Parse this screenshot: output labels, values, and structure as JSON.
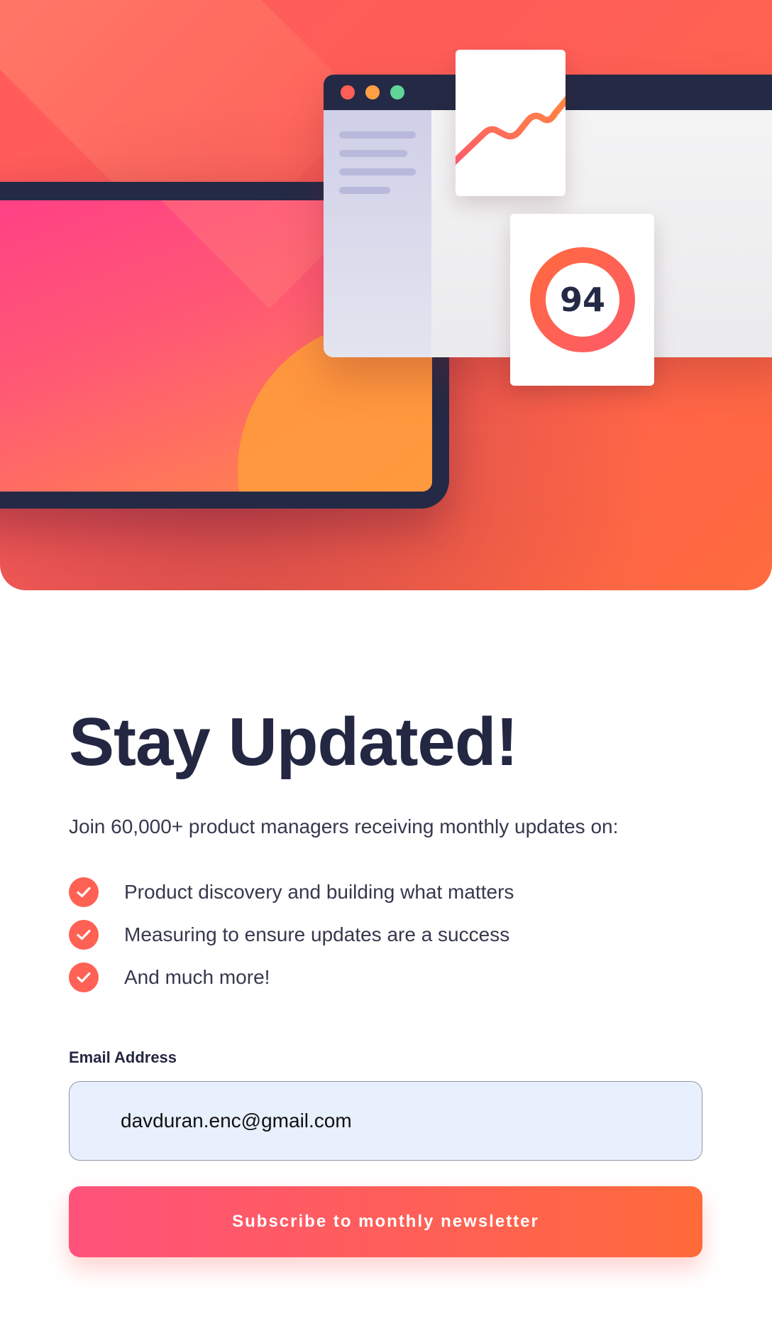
{
  "hero": {
    "score_card": {
      "value": "94"
    },
    "browser": {
      "window_dots": [
        "red",
        "orange",
        "green"
      ],
      "dot_colors": [
        "#ff5f57",
        "#ff9f43",
        "#5fd597"
      ]
    },
    "chart_card": {
      "icon": "trend-line"
    },
    "colors": {
      "gradient_start": "#ff527b",
      "gradient_end": "#ff6a3a",
      "dark": "#242a45"
    }
  },
  "main": {
    "title": "Stay Updated!",
    "subtitle": "Join 60,000+ product managers receiving monthly updates on:",
    "features": [
      {
        "icon": "check-icon",
        "text": "Product discovery and building what matters"
      },
      {
        "icon": "check-icon",
        "text": "Measuring to ensure updates are a success"
      },
      {
        "icon": "check-icon",
        "text": "And much more!"
      }
    ]
  },
  "form": {
    "email_label": "Email Address",
    "email_value": "davduran.enc@gmail.com",
    "submit_label": "Subscribe to monthly newsletter"
  },
  "colors": {
    "accent": "#ff6155",
    "heading": "#242742",
    "body_text": "#36384d",
    "input_bg": "#e8f0fe"
  }
}
